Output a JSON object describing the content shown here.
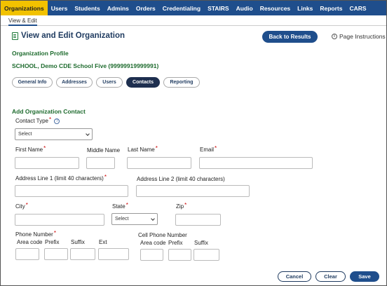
{
  "topnav": {
    "items": [
      "Organizations",
      "Users",
      "Students",
      "Admins",
      "Orders",
      "Credentialing",
      "STAIRS",
      "Audio",
      "Resources",
      "Links",
      "Reports",
      "CARS"
    ],
    "active": "Organizations"
  },
  "subnav": {
    "label": "View & Edit"
  },
  "header": {
    "title": "View and Edit Organization",
    "back_label": "Back to Results",
    "instructions_label": "Page Instructions"
  },
  "profile": {
    "heading": "Organization Profile",
    "org_name": "SCHOOL, Demo CDE School Five (99999919999991)"
  },
  "tabs": [
    "General Info",
    "Addresses",
    "Users",
    "Contacts",
    "Reporting"
  ],
  "active_tab": "Contacts",
  "form": {
    "title": "Add Organization Contact",
    "contact_type_label": "Contact Type",
    "contact_type_value": "Select",
    "first_name_label": "First Name",
    "middle_name_label": "Middle Name",
    "last_name_label": "Last Name",
    "email_label": "Email",
    "address1_label": "Address Line 1 (limit 40 characters)",
    "address2_label": "Address Line 2 (limit 40 characters)",
    "city_label": "City",
    "state_label": "State",
    "state_value": "Select",
    "zip_label": "Zip",
    "phone_label": "Phone Number",
    "cell_label": "Cell Phone Number",
    "area_code_label": "Area code",
    "prefix_label": "Prefix",
    "suffix_label": "Suffix",
    "ext_label": "Ext",
    "required_mark": "*"
  },
  "actions": {
    "cancel": "Cancel",
    "clear": "Clear",
    "save": "Save"
  },
  "colors": {
    "nav_bg": "#1f4e8c",
    "nav_active": "#f2c200",
    "heading_green": "#1e6b2e",
    "required_red": "#cc0000"
  }
}
